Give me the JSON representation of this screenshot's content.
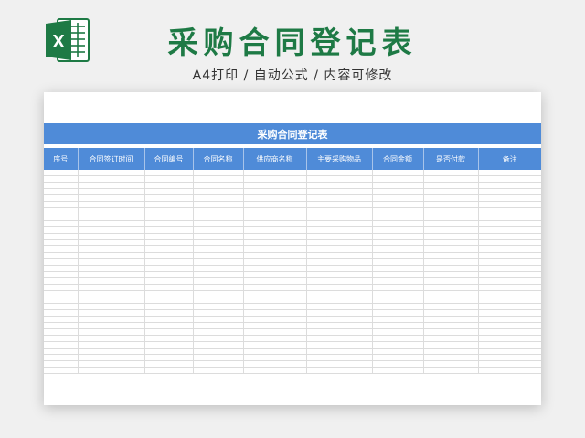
{
  "header": {
    "logo_letter": "X",
    "logo_color": "#1e7a45",
    "title": "采购合同登记表",
    "subtitle": "A4打印 / 自动公式 / 内容可修改"
  },
  "sheet": {
    "banner_title": "采购合同登记表",
    "accent_color": "#4f8bd8",
    "columns": [
      "序号",
      "合同签订时间",
      "合同编号",
      "合同名称",
      "供应商名称",
      "主要采购物品",
      "合同金额",
      "是否付款",
      "备注"
    ],
    "empty_row_count": 32
  }
}
